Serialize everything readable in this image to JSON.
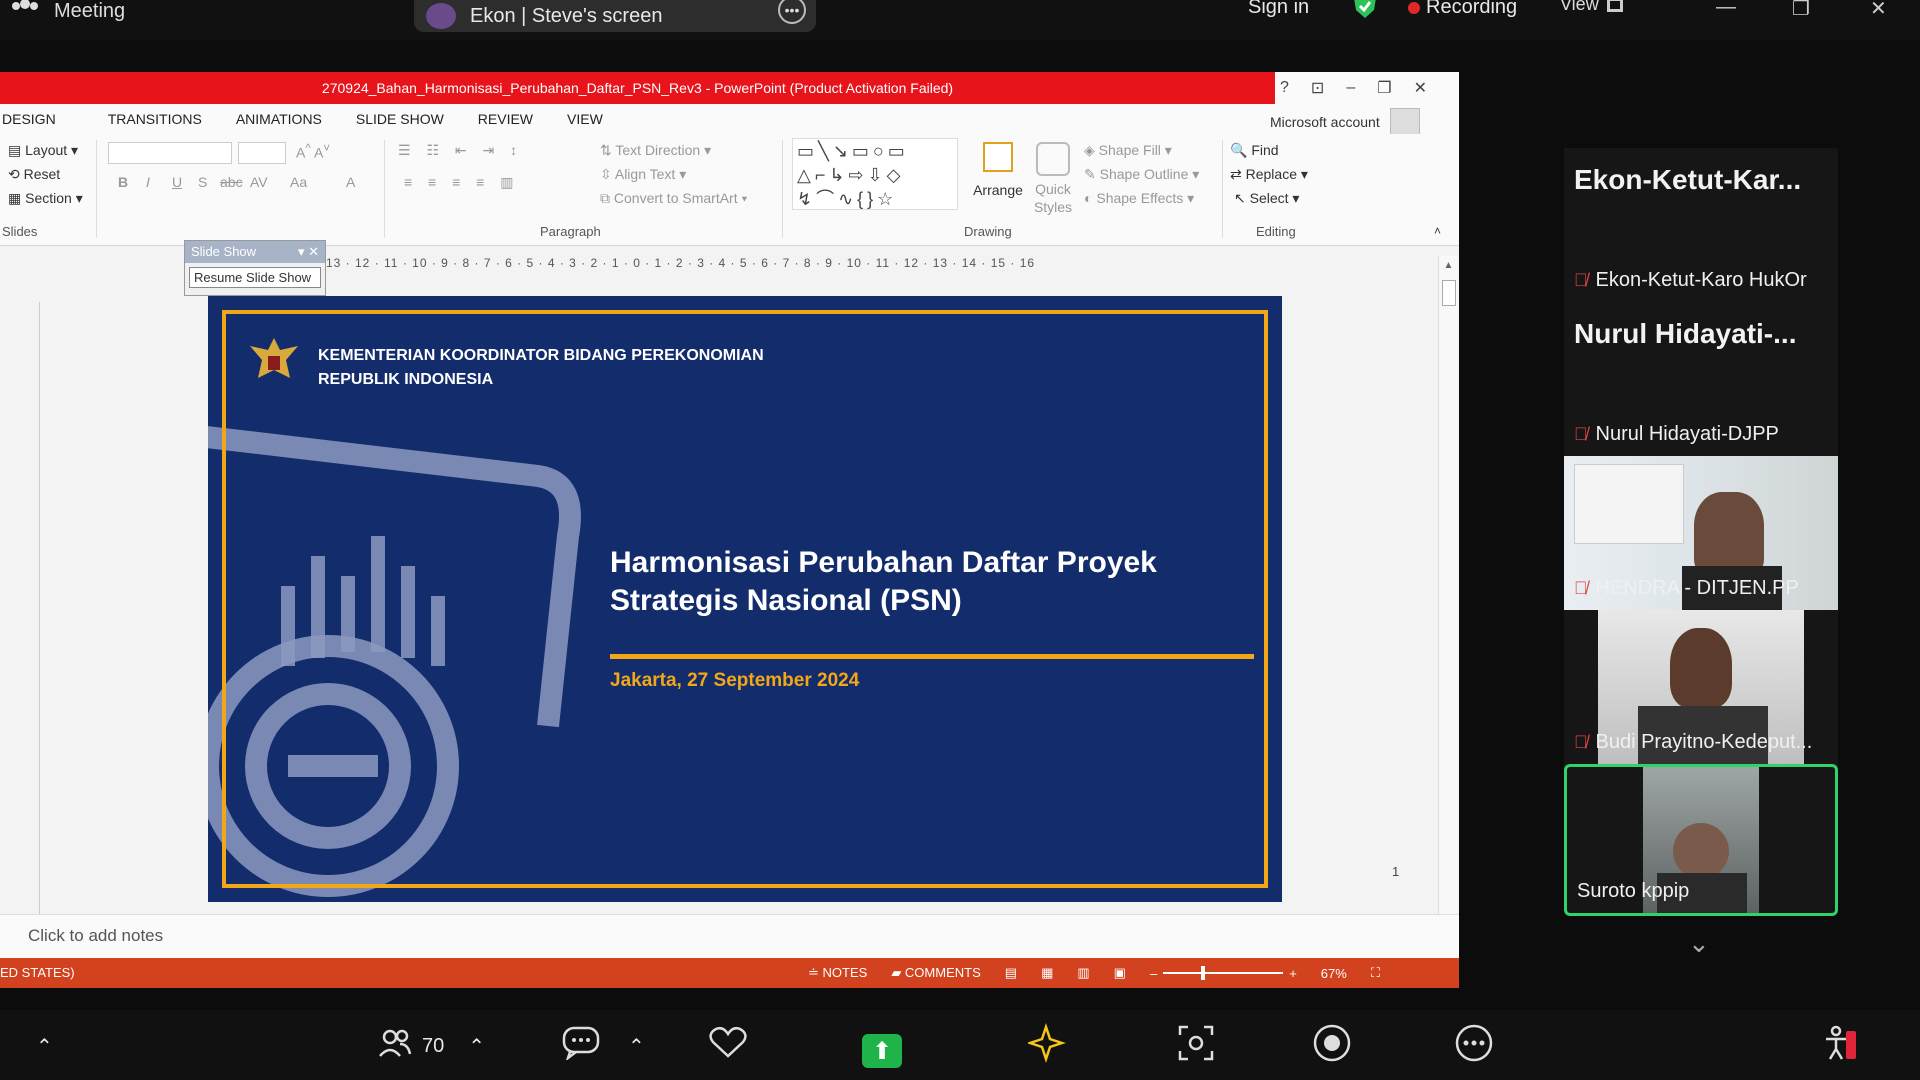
{
  "zoom_top": {
    "meeting_label": "Meeting",
    "share_label": "Ekon | Steve's screen",
    "signin": "Sign in",
    "recording": "Recording",
    "view": "View"
  },
  "ppt": {
    "window_title": "270924_Bahan_Harmonisasi_Perubahan_Daftar_PSN_Rev3 - PowerPoint (Product Activation Failed)",
    "title_icons": [
      "?",
      "⊡",
      "–",
      "❐",
      "✕"
    ],
    "menu": [
      "DESIGN",
      "TRANSITIONS",
      "ANIMATIONS",
      "SLIDE SHOW",
      "REVIEW",
      "VIEW"
    ],
    "account": "Microsoft account",
    "ribbon": {
      "layout": "Layout",
      "reset": "Reset",
      "section": "Section",
      "slides_group": "Slides",
      "text_direction": "Text Direction",
      "align_text": "Align Text",
      "convert_smartart": "Convert to SmartArt",
      "paragraph_group": "Paragraph",
      "arrange": "Arrange",
      "quick_styles": "Quick Styles",
      "shape_fill": "Shape Fill",
      "shape_outline": "Shape Outline",
      "shape_effects": "Shape Effects",
      "drawing_group": "Drawing",
      "find": "Find",
      "replace": "Replace",
      "select": "Select",
      "editing_group": "Editing"
    },
    "slideshow_popup": {
      "title": "Slide Show",
      "button": "Resume Slide Show"
    },
    "ruler": "13 · 12 · 11 · 10 · 9 · 8 · 7 · 6 · 5 · 4 · 3 · 2 · 1 · 0 · 1 · 2 · 3 · 4 · 5 · 6 · 7 · 8 · 9 · 10 · 11 · 12 · 13 · 14 · 15 · 16",
    "slide": {
      "ministry_line1": "KEMENTERIAN KOORDINATOR BIDANG PEREKONOMIAN",
      "ministry_line2": "REPUBLIK INDONESIA",
      "title_line1": "Harmonisasi Perubahan Daftar Proyek",
      "title_line2": "Strategis Nasional (PSN)",
      "date": "Jakarta, 27 September 2024"
    },
    "page_number": "1",
    "notes_placeholder": "Click to add notes",
    "status_left": "ED STATES)",
    "status_notes": "NOTES",
    "status_comments": "COMMENTS",
    "zoom_level": "67%"
  },
  "participants": [
    {
      "big": "Ekon-Ketut-Kar...",
      "name": "Ekon-Ketut-Karo HukOr"
    },
    {
      "big": "Nurul  Hidayati-...",
      "name": "Nurul Hidayati-DJPP"
    },
    {
      "name": "HENDRA - DITJEN.PP"
    },
    {
      "name": "Budi Prayitno-Kedeput..."
    },
    {
      "name": "Suroto kppip"
    }
  ],
  "toolbar": {
    "participants_count": "70"
  },
  "colors": {
    "slide_bg": "#132c6c",
    "slide_accent": "#f2a719",
    "title_bar": "#e8141c",
    "status_bar": "#d2421e",
    "share_green": "#1fb44a",
    "active_speaker": "#2fd36a"
  }
}
